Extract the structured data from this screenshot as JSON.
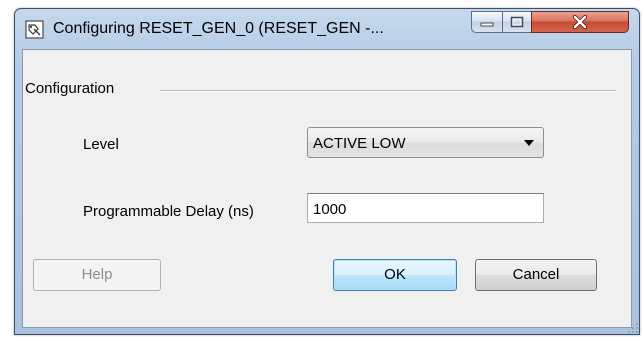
{
  "window": {
    "title": "Configuring RESET_GEN_0 (RESET_GEN -..."
  },
  "icons": {
    "app": "dialog-app-icon",
    "minimize": "minimize-icon",
    "maximize": "maximize-icon",
    "close": "close-icon",
    "dropdown": "chevron-down-icon",
    "grip": "resize-grip-icon"
  },
  "configuration": {
    "group_label": "Configuration",
    "level_label": "Level",
    "level_value": "ACTIVE LOW",
    "delay_label": "Programmable Delay (ns)",
    "delay_value": "1000"
  },
  "buttons": {
    "help": "Help",
    "ok": "OK",
    "cancel": "Cancel"
  },
  "colors": {
    "title_bar": "#b3cbe6",
    "close_button": "#c54a33",
    "ok_button_border": "#3c7fb1",
    "client_background": "#f0f0f0"
  }
}
